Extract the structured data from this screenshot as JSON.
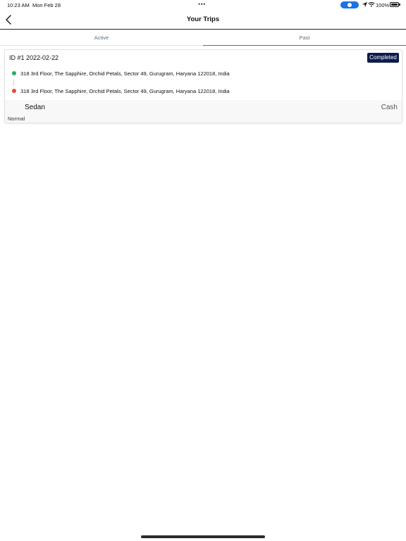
{
  "status_bar": {
    "time": "10:23 AM",
    "date": "Mon Feb 28",
    "battery": "100%",
    "icons": [
      "location-arrow-icon",
      "wifi-icon",
      "battery-icon"
    ]
  },
  "header": {
    "title": "Your Trips",
    "back_icon": "chevron-left-icon"
  },
  "tabs": [
    {
      "label": "Active",
      "selected": false
    },
    {
      "label": "Past",
      "selected": true
    }
  ],
  "trips": [
    {
      "id_label": "ID #1 2022-02-22",
      "status": "Completed",
      "pickup": "318 3rd Floor, The Sapphire, Orchid Petals, Sector 49, Gurugram, Haryana 122018, India",
      "dropoff": "318 3rd Floor, The Sapphire, Orchid Petals, Sector 49, Gurugram, Haryana 122018, India",
      "vehicle": "Sedan",
      "payment": "Cash",
      "category": "Normal"
    }
  ],
  "colors": {
    "badge_bg": "#0d1b4c",
    "pickup_dot": "#27ae60",
    "dropoff_dot": "#e74c3c",
    "tab_text": "#5b6e82",
    "accent_blue": "#1a73e8"
  }
}
